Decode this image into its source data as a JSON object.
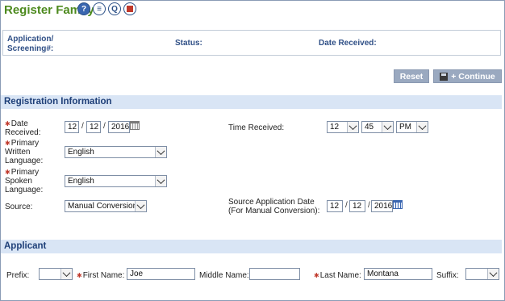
{
  "header": {
    "title": "Register Family",
    "icons": [
      {
        "name": "help-icon",
        "glyph": "?"
      },
      {
        "name": "document-icon",
        "glyph": "≡"
      },
      {
        "name": "query-icon",
        "glyph": "Q"
      },
      {
        "name": "stop-icon",
        "glyph": ""
      }
    ]
  },
  "application": {
    "app_label_line1": "Application/",
    "app_label_line2": "Screening#:",
    "status_label": "Status:",
    "date_received_label": "Date Received:"
  },
  "toolbar": {
    "reset_label": "Reset",
    "continue_label": "+ Continue"
  },
  "registration": {
    "section_title": "Registration Information",
    "date_received": {
      "label_line1": "Date",
      "label_line2": "Received:",
      "month": "12",
      "day": "12",
      "year": "2016"
    },
    "time_received": {
      "label": "Time Received:",
      "hour": "12",
      "minute": "45",
      "ampm": "PM"
    },
    "written_language": {
      "label_line1": "Primary",
      "label_line2": "Written",
      "label_line3": "Language:",
      "value": "English"
    },
    "spoken_language": {
      "label_line1": "Primary",
      "label_line2": "Spoken",
      "label_line3": "Language:",
      "value": "English"
    },
    "source": {
      "label": "Source:",
      "value": "Manual Conversion"
    },
    "source_app_date": {
      "label_line1": "Source Application Date",
      "label_line2": "(For Manual Conversion):",
      "month": "12",
      "day": "12",
      "year": "2016"
    }
  },
  "applicant": {
    "section_title": "Applicant",
    "prefix_label": "Prefix:",
    "prefix_value": "",
    "first_name_label": "First Name:",
    "first_name_value": "Joe",
    "middle_name_label": "Middle Name:",
    "middle_name_value": "",
    "last_name_label": "Last Name:",
    "last_name_value": "Montana",
    "suffix_label": "Suffix:",
    "suffix_value": ""
  },
  "colors": {
    "title": "#4d8a1e",
    "section_bg": "#d9e5f5",
    "section_text": "#1e3f78",
    "button_bg": "#9aa9c0",
    "required": "#c0392b"
  }
}
